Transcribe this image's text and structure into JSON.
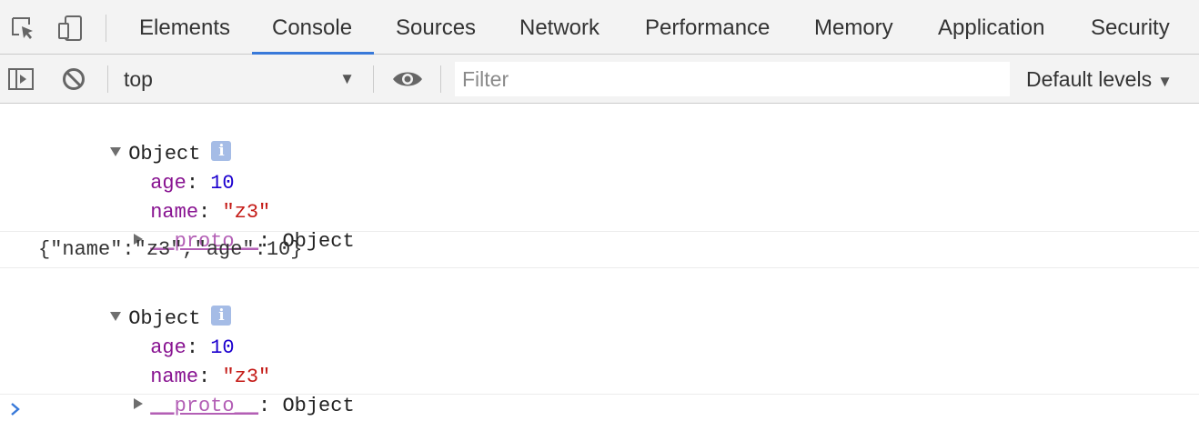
{
  "tabs": [
    {
      "label": "Elements",
      "active": false
    },
    {
      "label": "Console",
      "active": true
    },
    {
      "label": "Sources",
      "active": false
    },
    {
      "label": "Network",
      "active": false
    },
    {
      "label": "Performance",
      "active": false
    },
    {
      "label": "Memory",
      "active": false
    },
    {
      "label": "Application",
      "active": false
    },
    {
      "label": "Security",
      "active": false
    }
  ],
  "icons": {
    "inspect": "inspect-element-icon",
    "device": "device-toolbar-icon",
    "sidebar": "show-sidebar-icon",
    "clear": "clear-console-icon",
    "eye": "live-expression-eye-icon",
    "prompt": "console-prompt-icon"
  },
  "toolbar": {
    "context": "top",
    "context_arrow": "▼",
    "filter_placeholder": "Filter",
    "levels_label": "Default levels",
    "levels_arrow": "▼"
  },
  "console": {
    "messages": [
      {
        "type": "object",
        "header": "Object",
        "info_glyph": "i",
        "props": [
          {
            "key": "age",
            "sep": ": ",
            "value": "10"
          },
          {
            "key": "name",
            "sep": ": ",
            "value": "\"z3\""
          }
        ],
        "proto_key": "__proto__",
        "proto_sep": ": ",
        "proto_value": "Object"
      },
      {
        "type": "text",
        "text": "{\"name\":\"z3\",\"age\":10}"
      },
      {
        "type": "object",
        "header": "Object",
        "info_glyph": "i",
        "props": [
          {
            "key": "age",
            "sep": ": ",
            "value": "10"
          },
          {
            "key": "name",
            "sep": ": ",
            "value": "\"z3\""
          }
        ],
        "proto_key": "__proto__",
        "proto_sep": ": ",
        "proto_value": "Object"
      }
    ]
  },
  "colors": {
    "accent": "#3879d9",
    "key": "#881391",
    "number": "#1c00cf",
    "string": "#c41a16",
    "prompt": "#3879d9"
  }
}
